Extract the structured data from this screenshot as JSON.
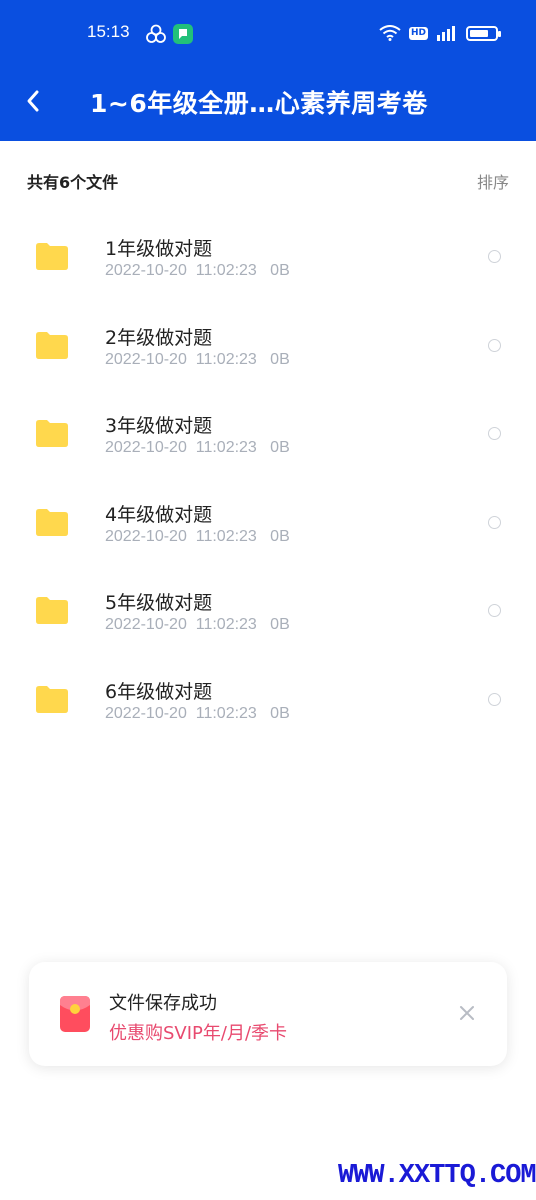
{
  "status_bar": {
    "time": "15:13",
    "hd_label": "HD",
    "battery_level": 0.8,
    "icons": [
      "app-cluster-icon",
      "app-chat-icon",
      "wifi-icon",
      "hd-icon",
      "signal-icon",
      "battery-icon"
    ]
  },
  "header": {
    "title": "1~6年级全册…心素养周考卷",
    "back_icon": "chevron-left-icon",
    "background_color": "#0a4fe0"
  },
  "summary": {
    "file_count_label": "共有6个文件",
    "sort_label": "排序"
  },
  "files": [
    {
      "name": "1年级做对题",
      "meta": "2022-10-20  11:02:23   0B"
    },
    {
      "name": "2年级做对题",
      "meta": "2022-10-20  11:02:23   0B"
    },
    {
      "name": "3年级做对题",
      "meta": "2022-10-20  11:02:23   0B"
    },
    {
      "name": "4年级做对题",
      "meta": "2022-10-20  11:02:23   0B"
    },
    {
      "name": "5年级做对题",
      "meta": "2022-10-20  11:02:23   0B"
    },
    {
      "name": "6年级做对题",
      "meta": "2022-10-20  11:02:23   0B"
    }
  ],
  "toast": {
    "title": "文件保存成功",
    "subtitle": "优惠购SVIP年/月/季卡",
    "icon": "red-envelope-icon",
    "close_icon": "close-icon",
    "accent_color": "#e84a6f"
  },
  "watermark": "WWW.XXTTQ.COM",
  "colors": {
    "folder": "#ffd84d",
    "meta_text": "#a9afb9"
  }
}
